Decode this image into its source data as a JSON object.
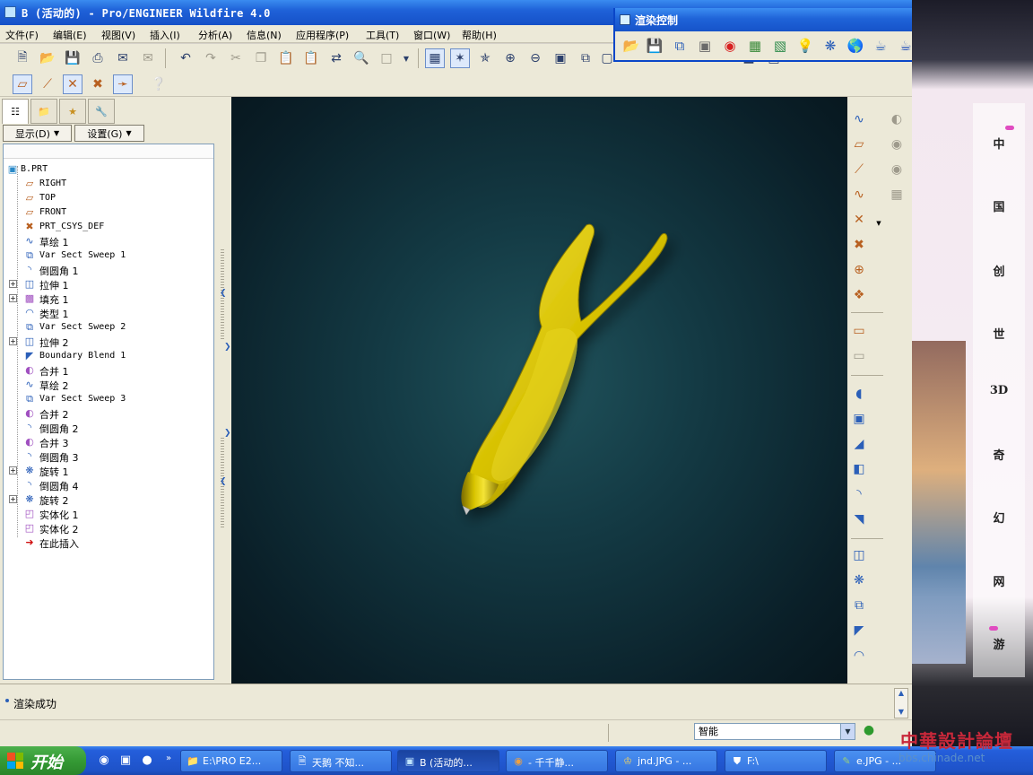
{
  "window": {
    "title": "B (活动的) - Pro/ENGINEER Wildfire 4.0"
  },
  "menu": [
    {
      "label": "文件(F)"
    },
    {
      "label": "编辑(E)"
    },
    {
      "label": "视图(V)"
    },
    {
      "label": "插入(I)"
    },
    {
      "label": "分析(A)"
    },
    {
      "label": "信息(N)"
    },
    {
      "label": "应用程序(P)"
    },
    {
      "label": "工具(T)"
    },
    {
      "label": "窗口(W)"
    },
    {
      "label": "帮助(H)"
    }
  ],
  "toolbar_icons": {
    "row1": [
      "new-file-icon",
      "open-file-icon",
      "save-icon",
      "print-icon",
      "email-icon",
      "undo-icon",
      "redo-icon",
      "cut-icon",
      "copy-icon",
      "paste-icon",
      "regenerate-icon",
      "find-icon",
      "select-box-icon",
      "redraw-icon",
      "spin-center-icon",
      "orient-icon",
      "zoom-in-icon",
      "zoom-out-icon",
      "refit-icon",
      "reorient-icon",
      "saved-views-icon",
      "layers-icon",
      "view-manager-icon",
      "shading-icon"
    ],
    "row2": [
      "datum-planes-icon",
      "datum-axes-icon",
      "datum-points-icon",
      "coord-sys-icon",
      "whats-this-icon"
    ]
  },
  "left_panel": {
    "tabs": [
      "model-tree-icon",
      "folder-browser-icon",
      "favorites-icon",
      "connections-icon"
    ],
    "show_label": "显示(D)",
    "settings_label": "设置(G)"
  },
  "model_tree": {
    "root": "B.PRT",
    "items": [
      {
        "label": "RIGHT",
        "icon": "datum-plane-icon",
        "expandable": false,
        "mono": true
      },
      {
        "label": "TOP",
        "icon": "datum-plane-icon",
        "expandable": false,
        "mono": true
      },
      {
        "label": "FRONT",
        "icon": "datum-plane-icon",
        "expandable": false,
        "mono": true
      },
      {
        "label": "PRT_CSYS_DEF",
        "icon": "coord-sys-icon",
        "expandable": false,
        "mono": true
      },
      {
        "label": "草绘 1",
        "icon": "sketch-icon",
        "expandable": false,
        "mono": false
      },
      {
        "label": "Var Sect Sweep 1",
        "icon": "var-sect-sweep-icon",
        "expandable": false,
        "mono": true
      },
      {
        "label": "倒圆角 1",
        "icon": "round-icon",
        "expandable": false,
        "mono": false
      },
      {
        "label": "拉伸 1",
        "icon": "extrude-icon",
        "expandable": true,
        "mono": false
      },
      {
        "label": "填充 1",
        "icon": "fill-icon",
        "expandable": true,
        "mono": false
      },
      {
        "label": "类型 1",
        "icon": "type-icon",
        "expandable": false,
        "mono": false
      },
      {
        "label": "Var Sect Sweep 2",
        "icon": "var-sect-sweep-icon",
        "expandable": false,
        "mono": true
      },
      {
        "label": "拉伸 2",
        "icon": "extrude-icon",
        "expandable": true,
        "mono": false
      },
      {
        "label": "Boundary Blend 1",
        "icon": "boundary-blend-icon",
        "expandable": false,
        "mono": true
      },
      {
        "label": "合并 1",
        "icon": "merge-icon",
        "expandable": false,
        "mono": false
      },
      {
        "label": "草绘 2",
        "icon": "sketch-icon",
        "expandable": false,
        "mono": false
      },
      {
        "label": "Var Sect Sweep 3",
        "icon": "var-sect-sweep-icon",
        "expandable": false,
        "mono": true
      },
      {
        "label": "合并 2",
        "icon": "merge-icon",
        "expandable": false,
        "mono": false
      },
      {
        "label": "倒圆角 2",
        "icon": "round-icon",
        "expandable": false,
        "mono": false
      },
      {
        "label": "合并 3",
        "icon": "merge-icon",
        "expandable": false,
        "mono": false
      },
      {
        "label": "倒圆角 3",
        "icon": "round-icon",
        "expandable": false,
        "mono": false
      },
      {
        "label": "旋转 1",
        "icon": "revolve-icon",
        "expandable": true,
        "mono": false
      },
      {
        "label": "倒圆角 4",
        "icon": "round-icon",
        "expandable": false,
        "mono": false
      },
      {
        "label": "旋转 2",
        "icon": "revolve-icon",
        "expandable": true,
        "mono": false
      },
      {
        "label": "实体化 1",
        "icon": "solidify-icon",
        "expandable": false,
        "mono": false
      },
      {
        "label": "实体化 2",
        "icon": "solidify-icon",
        "expandable": false,
        "mono": false
      },
      {
        "label": "在此插入",
        "icon": "insert-here-arrow-icon",
        "expandable": false,
        "mono": false
      }
    ]
  },
  "right_tools": {
    "col1": [
      "sketched-curve-icon",
      "datum-plane-tool-icon",
      "datum-axis-tool-icon",
      "datum-curve-icon",
      "datum-point-icon",
      "coordinate-system-icon",
      "analysis-feature-icon",
      "insert-datum-icon",
      "sketch-tool-icon",
      "hole-icon",
      "shell-icon",
      "draft-icon",
      "rib-icon",
      "round-tool-icon",
      "chamfer-icon",
      "extrude-tool-icon",
      "revolve-tool-icon",
      "sweep-tool-icon",
      "blend-tool-icon",
      "style-icon"
    ],
    "col2": [
      "copy-feature-icon",
      "mirror-icon",
      "merge-tool-icon",
      "pattern-icon"
    ]
  },
  "message": {
    "text": "渲染成功"
  },
  "status": {
    "filter_value": "智能"
  },
  "render_window": {
    "title": "渲染控制",
    "tools": [
      "open-scene-icon",
      "save-scene-icon",
      "export-icon",
      "room-icon",
      "appearance-icon",
      "scene-icon",
      "background-icon",
      "lights-icon",
      "effects-icon",
      "environment-icon",
      "render-icon",
      "region-render-icon",
      "render-settings-icon"
    ]
  },
  "wallpaper": {
    "chars": [
      "中",
      "国",
      "创",
      "世",
      "3D",
      "奇",
      "幻",
      "网",
      "游"
    ]
  },
  "watermark": {
    "line1": "中華設計論壇",
    "line2": "bbs.chinade.net"
  },
  "taskbar": {
    "start_label": "开始",
    "tasks": [
      {
        "label": "E:\\PRO E2...",
        "icon": "folder-icon"
      },
      {
        "label": "天鹅 不知...",
        "icon": "document-icon"
      },
      {
        "label": "B (活动的...",
        "icon": "proe-icon"
      },
      {
        "label": "- 千千静...",
        "icon": "player-icon"
      },
      {
        "label": "jnd.JPG - ...",
        "icon": "image-viewer-icon"
      },
      {
        "label": "F:\\",
        "icon": "drive-icon"
      },
      {
        "label": "e.JPG - ...",
        "icon": "paint-icon"
      }
    ]
  }
}
